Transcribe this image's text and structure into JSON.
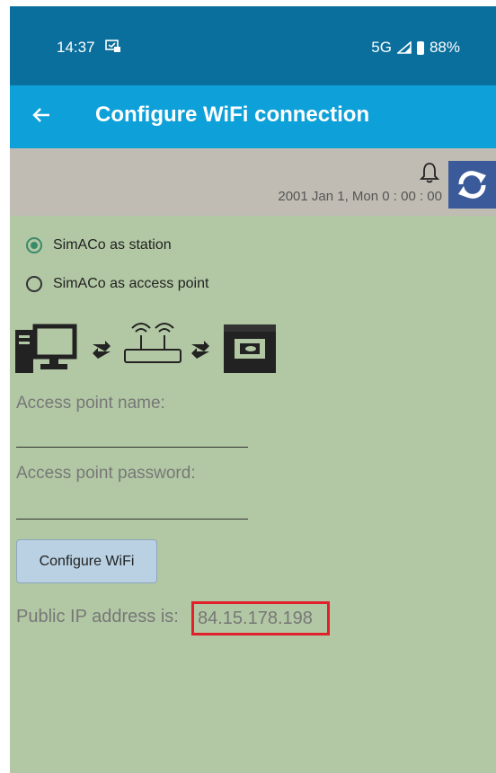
{
  "status_bar": {
    "time": "14:37",
    "network": "5G",
    "battery": "88%"
  },
  "app_bar": {
    "title": "Configure WiFi connection"
  },
  "info_bar": {
    "datetime": "2001  Jan  1,  Mon   0 : 00 : 00"
  },
  "mode": {
    "options": [
      {
        "label": "SimACo as station",
        "selected": true
      },
      {
        "label": "SimACo as access point",
        "selected": false
      }
    ]
  },
  "form": {
    "ap_name_label": "Access point name:",
    "ap_name_value": "",
    "ap_password_label": "Access point password:",
    "ap_password_value": "",
    "configure_button": "Configure WiFi"
  },
  "ip": {
    "label": "Public IP address is:",
    "value": "84.15.178.198"
  },
  "colors": {
    "status_bar": "#0a6f9c",
    "app_bar": "#0ea0d8",
    "background": "#b2c8a4",
    "highlight": "#e0202a"
  }
}
